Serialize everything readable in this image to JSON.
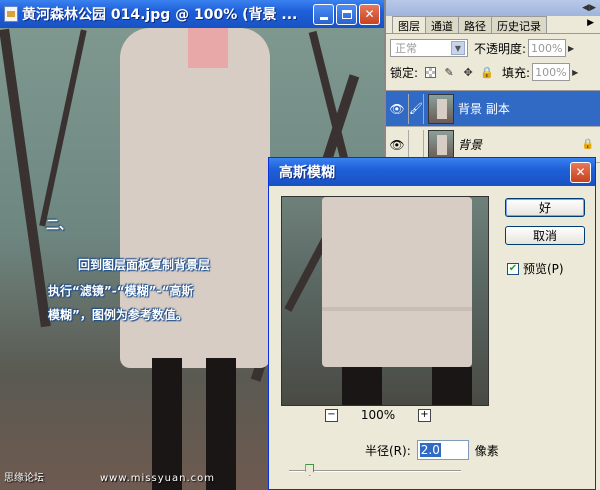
{
  "document": {
    "title": "黄河森林公园 014.jpg @ 100% (背景 ...",
    "tutorial": {
      "step": "二、",
      "line1": "回到图层面板复制背景层",
      "line2": "执行“滤镜”-“模糊”-“高斯",
      "line3": "模糊”，图例为参考数值。"
    },
    "watermark_left": "思缘论坛",
    "watermark_mid": "www.missyuan.com"
  },
  "layers_panel": {
    "tabs": [
      "图层",
      "通道",
      "路径",
      "历史记录"
    ],
    "blend_mode": "正常",
    "opacity_label": "不透明度:",
    "opacity_value": "100%",
    "lock_label": "锁定:",
    "fill_label": "填充:",
    "fill_value": "100%",
    "layers": [
      {
        "name": "背景 副本",
        "selected": true
      },
      {
        "name": "背景",
        "selected": false,
        "italic": true,
        "locked": true
      }
    ]
  },
  "dialog": {
    "title": "高斯模糊",
    "ok_label": "好",
    "cancel_label": "取消",
    "preview_label": "预览(P)",
    "preview_checked": true,
    "zoom_value": "100%",
    "radius_label": "半径(R):",
    "radius_value": "2.0",
    "radius_unit": "像素",
    "radius_slider_fraction": 0.1
  }
}
